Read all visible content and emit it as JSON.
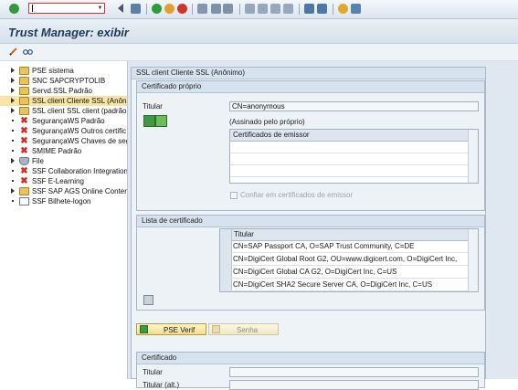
{
  "window": {
    "title": "Trust Manager: exibir"
  },
  "command_field": {
    "value": "",
    "placeholder": ""
  },
  "tree": {
    "items": [
      {
        "label": "PSE sistema",
        "icon": "folder-icon",
        "expander": "arrow"
      },
      {
        "label": "SNC SAPCRYPTOLIB",
        "icon": "folder-icon",
        "expander": "arrow"
      },
      {
        "label": "Servd.SSL Padrão",
        "icon": "folder-icon",
        "expander": "arrow"
      },
      {
        "label": "SSL client Cliente SSL (Anônim",
        "icon": "folder-icon",
        "expander": "arrow",
        "selected": true
      },
      {
        "label": "SSL client SSL client (padrão",
        "icon": "folder-icon",
        "expander": "arrow"
      },
      {
        "label": "SegurançaWS Padrão",
        "icon": "red-x-icon",
        "expander": "dot"
      },
      {
        "label": "SegurançaWS Outros certific",
        "icon": "red-x-icon",
        "expander": "dot"
      },
      {
        "label": "SegurançaWS Chaves de seg",
        "icon": "red-x-icon",
        "expander": "dot"
      },
      {
        "label": "SMIME Padrão",
        "icon": "red-x-icon",
        "expander": "dot"
      },
      {
        "label": "File",
        "icon": "shield-icon",
        "expander": "arrow"
      },
      {
        "label": "SSF Collaboration Integration",
        "icon": "red-x-icon",
        "expander": "dot"
      },
      {
        "label": "SSF E-Learning",
        "icon": "red-x-icon",
        "expander": "dot"
      },
      {
        "label": "SSF SAP AGS Online Content",
        "icon": "folder-icon",
        "expander": "arrow"
      },
      {
        "label": "SSF Bilhete-logon",
        "icon": "certificate-icon",
        "expander": "dot"
      }
    ]
  },
  "detail": {
    "header": "SSL client Cliente SSL (Anônimo)",
    "own_cert": {
      "group_title": "Certificado próprio",
      "owner_label": "Titular",
      "owner_value": "CN=anonymous",
      "self_signed": "(Assinado pelo próprio)",
      "issuer_table_header": "Certificados de emissor",
      "trust_label": "Confiar em certificados de emissor"
    },
    "cert_list": {
      "group_title": "Lista de certificado",
      "column": "Titular",
      "rows": [
        "CN=SAP Passport CA, O=SAP Trust Community, C=DE",
        "CN=DigiCert Global Root G2, OU=www.digicert.com, O=DigiCert Inc,",
        "CN=DigiCert Global CA G2, O=DigiCert Inc, C=US",
        "CN=DigiCert SHA2 Secure Server CA, O=DigiCert Inc, C=US"
      ]
    },
    "buttons": {
      "pse_verif": "PSE Verif",
      "senha": "Senha"
    },
    "certificate": {
      "group_title": "Certificado",
      "owner_label": "Titular",
      "owner_alt_label": "Titular (alt.)"
    }
  }
}
